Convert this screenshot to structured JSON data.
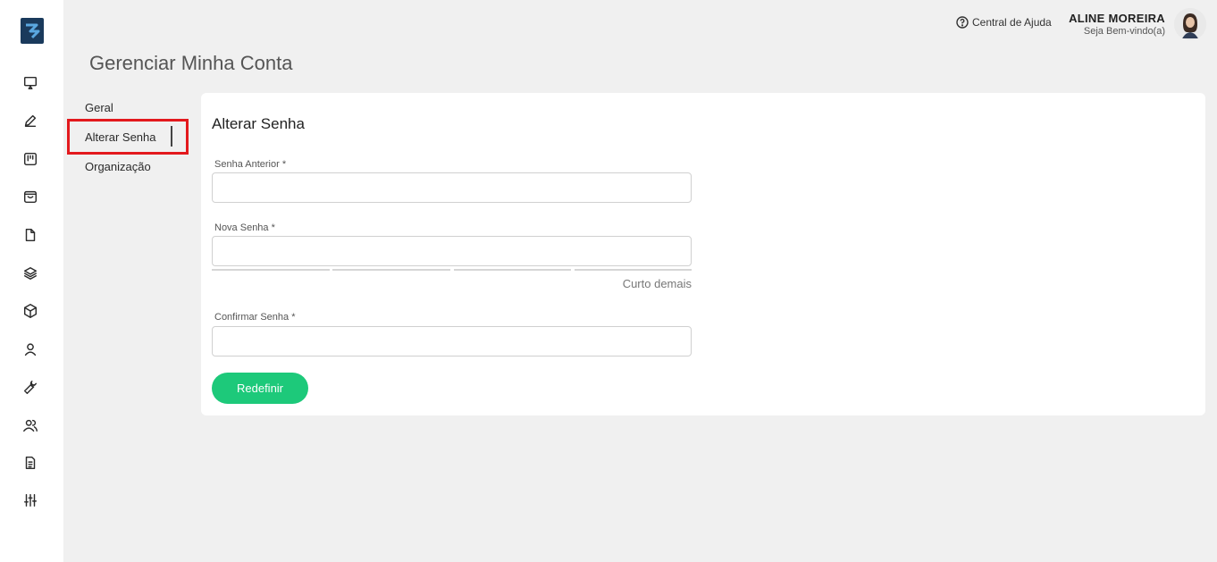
{
  "header": {
    "help_label": "Central de Ajuda",
    "user_name": "ALINE MOREIRA",
    "user_greeting": "Seja Bem-vindo(a)"
  },
  "page": {
    "title": "Gerenciar Minha Conta"
  },
  "sidebar": {
    "icons": [
      "presentation-icon",
      "pencil-icon",
      "board-icon",
      "bag-icon",
      "file-icon",
      "layers-icon",
      "package-icon",
      "user-icon",
      "wrench-icon",
      "users-icon",
      "document-icon",
      "sliders-icon"
    ]
  },
  "subnav": {
    "items": [
      {
        "label": "Geral"
      },
      {
        "label": "Alterar Senha",
        "active": true
      },
      {
        "label": "Organização"
      }
    ]
  },
  "form": {
    "title": "Alterar Senha",
    "old_password_label": "Senha Anterior *",
    "new_password_label": "Nova Senha *",
    "strength_label": "Curto demais",
    "confirm_password_label": "Confirmar Senha *",
    "submit_label": "Redefinir"
  },
  "colors": {
    "accent": "#1dc97a",
    "highlight": "#e3191d",
    "logo": "#1a3a5c"
  }
}
